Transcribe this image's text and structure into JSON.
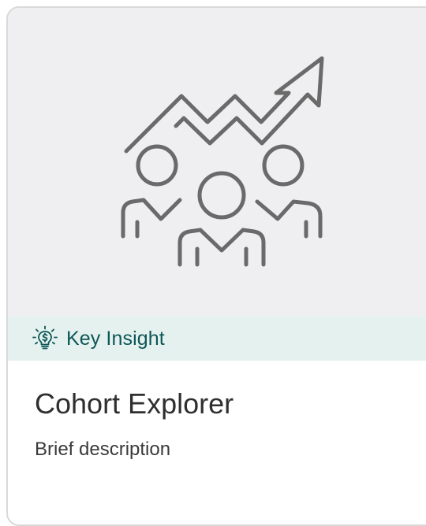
{
  "card": {
    "tag": {
      "icon": "lightbulb-icon",
      "label": "Key Insight"
    },
    "illustration": {
      "icon": "growing-team-icon"
    },
    "title": "Cohort Explorer",
    "description": "Brief description"
  },
  "colors": {
    "hero_background": "#efeff1",
    "tag_background": "#e5f1ef",
    "tag_text": "#0d5757",
    "illustration_stroke": "#6a6a6a",
    "card_border": "#d9d9d9"
  }
}
